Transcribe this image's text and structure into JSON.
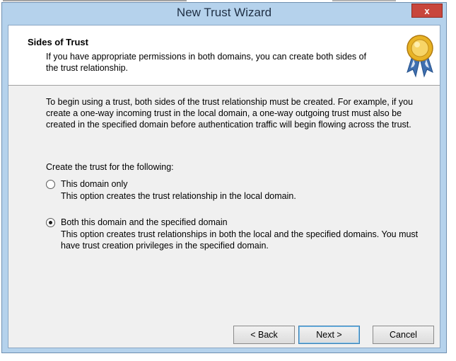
{
  "window": {
    "title": "New Trust Wizard",
    "close_label": "x"
  },
  "header": {
    "title": "Sides of Trust",
    "description": "If you have appropriate permissions in both domains, you can create both sides of the trust relationship.",
    "icon": "award-ribbon-icon"
  },
  "body": {
    "intro": "To begin using a trust, both sides of the trust relationship must be created. For example, if you create a one-way incoming trust in the local domain, a one-way outgoing trust must also be created in the specified domain before authentication traffic will begin flowing across the trust.",
    "create_label": "Create the trust for the following:",
    "options": [
      {
        "label": "This domain only",
        "description": "This option creates the trust relationship in the local domain.",
        "selected": false
      },
      {
        "label": "Both this domain and the specified domain",
        "description": "This option creates trust relationships in both the local and the specified domains. You must have trust creation privileges in the specified domain.",
        "selected": true
      }
    ]
  },
  "buttons": {
    "back": "< Back",
    "next": "Next >",
    "cancel": "Cancel"
  },
  "colors": {
    "frame": "#b5d2ec",
    "close": "#c8463c",
    "client": "#f0f0f0"
  }
}
